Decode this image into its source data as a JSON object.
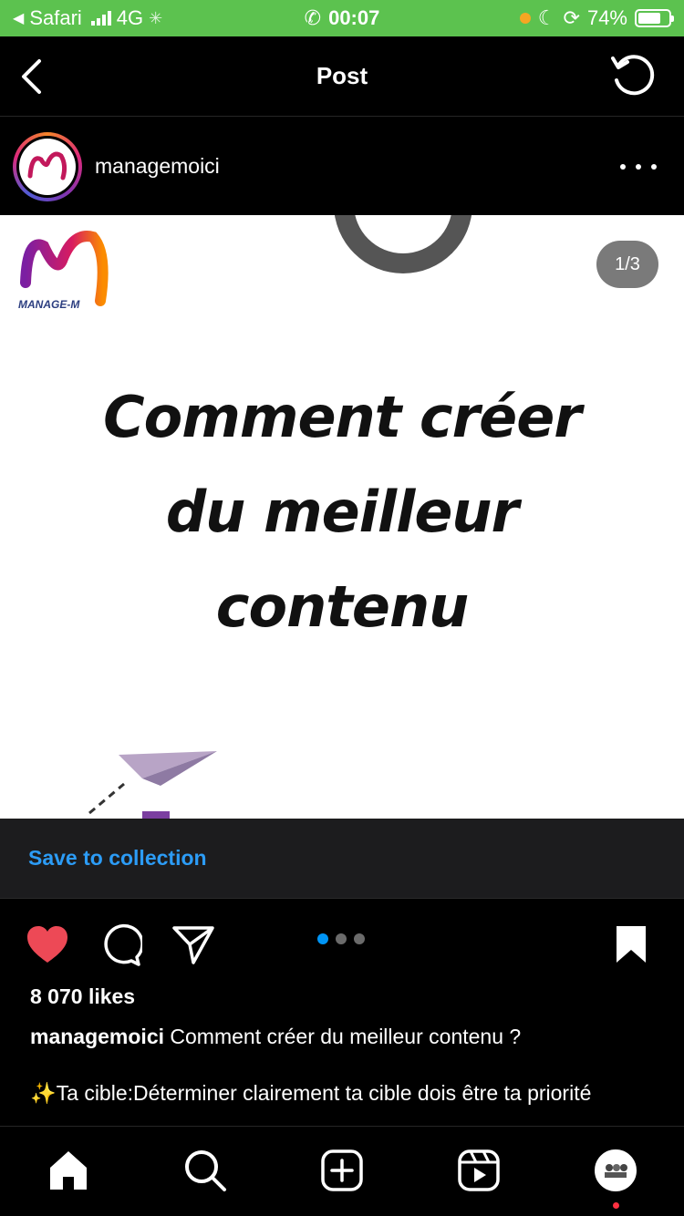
{
  "status_bar": {
    "back_app": "Safari",
    "network": "4G",
    "time": "00:07",
    "battery": "74%",
    "battery_level": 0.74
  },
  "header": {
    "title": "Post"
  },
  "post": {
    "username": "managemoici",
    "image_counter": "1/3",
    "headline_lines": [
      "Comment créer",
      "du meilleur",
      "contenu"
    ],
    "logo_text": "MANAGE-M"
  },
  "save_bar": {
    "label": "Save to collection"
  },
  "carousel": {
    "total": 3,
    "active_index": 0
  },
  "engagement": {
    "likes": "8 070 likes",
    "caption_user": "managemoici",
    "caption_text": "Comment créer du meilleur contenu ?",
    "caption_line2": "✨Ta cible:Déterminer clairement ta cible dois être ta priorité"
  },
  "colors": {
    "status_bar": "#5cc24f",
    "like_red": "#ed4956",
    "link_blue": "#2c9cf6",
    "active_dot": "#0095f6"
  },
  "icons": {
    "back": "chevron-left-icon",
    "refresh": "refresh-icon",
    "more": "more-horizontal-icon",
    "like": "heart-filled-icon",
    "comment": "comment-icon",
    "share": "paper-plane-icon",
    "save": "bookmark-filled-icon",
    "home": "home-icon",
    "search": "search-icon",
    "create": "plus-square-icon",
    "reels": "reels-icon"
  }
}
